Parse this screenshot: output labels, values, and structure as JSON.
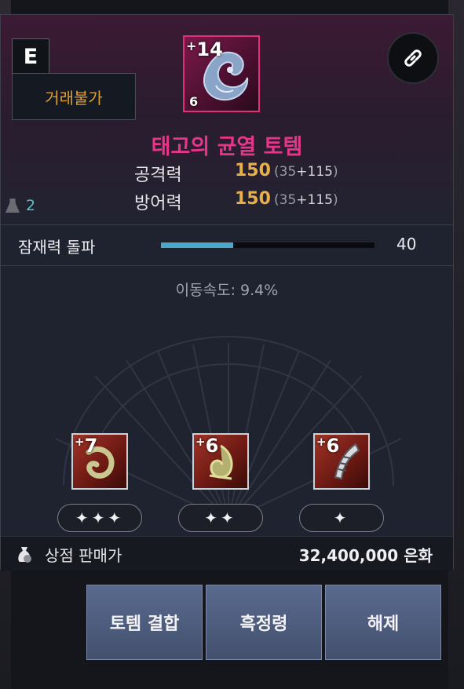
{
  "item": {
    "grade": "E",
    "trade_status": "거래불가",
    "name": "태고의 균열 토템",
    "enhance": "14",
    "level": "6",
    "weight": "2",
    "link_icon": "link-icon"
  },
  "stats": [
    {
      "label": "공격력",
      "value": "150",
      "detail_open": "(35",
      "detail_add": "+115",
      "detail_close": ")"
    },
    {
      "label": "방어력",
      "value": "150",
      "detail_open": "(35",
      "detail_add": "+115",
      "detail_close": ")"
    }
  ],
  "potential": {
    "label": "잠재력 돌파",
    "value": "40",
    "progress": 0.34
  },
  "effect": {
    "text": "이동속도: 9.4%"
  },
  "slots": [
    {
      "enhance": "7",
      "stars": "✦✦✦",
      "star_count": 3
    },
    {
      "enhance": "6",
      "stars": "✦✦",
      "star_count": 2
    },
    {
      "enhance": "6",
      "stars": "✦",
      "star_count": 1
    }
  ],
  "shop": {
    "label": "상점 판매가",
    "price": "32,400,000 은화"
  },
  "buttons": {
    "combine": "토템 결합",
    "black_spirit": "흑정령",
    "release": "해제"
  },
  "colors": {
    "item_name": "#e8358a",
    "stat_value": "#e8b04a",
    "trade_status": "#e0a030",
    "weight": "#5ec0c4",
    "potential_bar": "#4ea6c8"
  }
}
